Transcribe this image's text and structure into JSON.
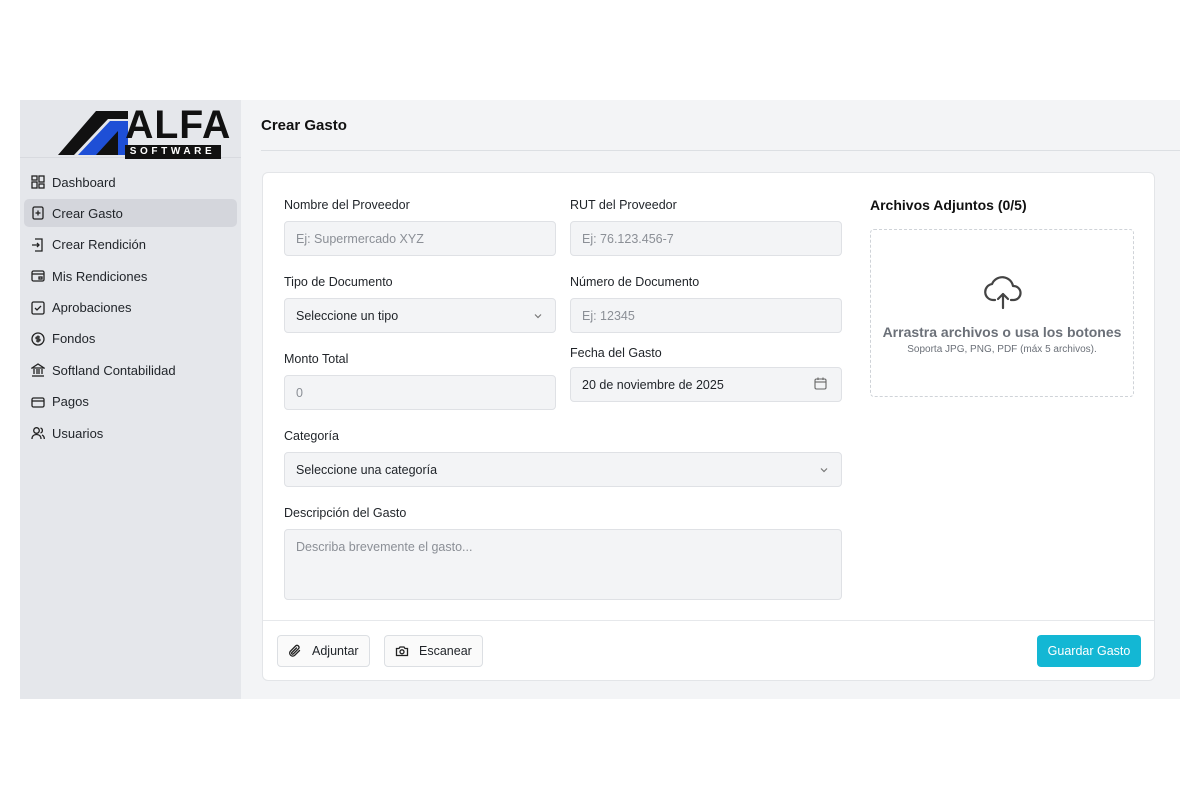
{
  "brand": {
    "name": "ALFA",
    "tagline": "SOFTWARE"
  },
  "sidebar": {
    "items": [
      {
        "label": "Dashboard",
        "icon": "dashboard-grid-icon"
      },
      {
        "label": "Crear Gasto",
        "icon": "file-plus-icon",
        "active": true
      },
      {
        "label": "Crear Rendición",
        "icon": "file-export-icon"
      },
      {
        "label": "Mis Rendiciones",
        "icon": "document-icon"
      },
      {
        "label": "Aprobaciones",
        "icon": "checkbox-icon"
      },
      {
        "label": "Fondos",
        "icon": "dollar-circle-icon"
      },
      {
        "label": "Softland Contabilidad",
        "icon": "bank-icon"
      },
      {
        "label": "Pagos",
        "icon": "credit-card-icon"
      },
      {
        "label": "Usuarios",
        "icon": "users-icon"
      }
    ]
  },
  "page": {
    "title": "Crear Gasto"
  },
  "form": {
    "proveedor": {
      "label": "Nombre del Proveedor",
      "placeholder": "Ej: Supermercado XYZ"
    },
    "rut": {
      "label": "RUT del Proveedor",
      "placeholder": "Ej: 76.123.456-7"
    },
    "tipo_documento": {
      "label": "Tipo de Documento",
      "value": "Seleccione un tipo"
    },
    "numero_documento": {
      "label": "Número de Documento",
      "placeholder": "Ej: 12345"
    },
    "monto": {
      "label": "Monto Total",
      "placeholder": "0"
    },
    "fecha": {
      "label": "Fecha del Gasto",
      "value": "20 de noviembre de 2025"
    },
    "categoria": {
      "label": "Categoría",
      "value": "Seleccione una categoría"
    },
    "descripcion": {
      "label": "Descripción del Gasto",
      "placeholder": "Describa brevemente el gasto..."
    }
  },
  "attachments": {
    "title": "Archivos Adjuntos (0/5)",
    "drop_main": "Arrastra archivos o usa los botones",
    "drop_sub": "Soporta JPG, PNG, PDF (máx 5 archivos)."
  },
  "actions": {
    "attach": "Adjuntar",
    "scan": "Escanear",
    "save": "Guardar Gasto"
  },
  "colors": {
    "primary": "#13b7d4",
    "sidebar_bg": "#e5e7eb",
    "active_item": "#d4d6dc",
    "logo_blue": "#1e4fd6"
  }
}
